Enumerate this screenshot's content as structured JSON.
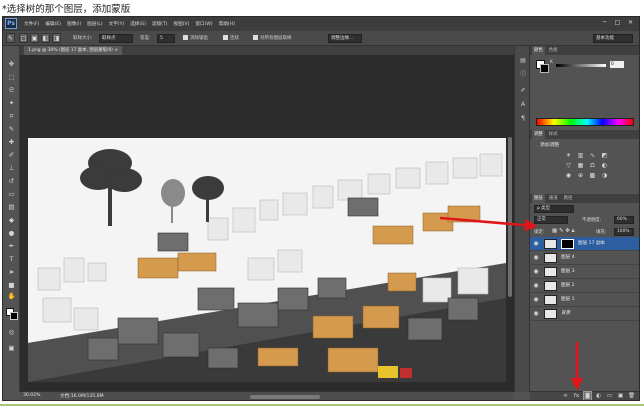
{
  "caption": "*选择树的那个图层，添加蒙版",
  "app": {
    "logo": "Ps",
    "menu": [
      "文件(F)",
      "编辑(E)",
      "图像(I)",
      "图层(L)",
      "文字(Y)",
      "选择(S)",
      "滤镜(T)",
      "视图(V)",
      "窗口(W)",
      "帮助(H)"
    ],
    "workspace": "基本功能",
    "window_controls": [
      "─",
      "□",
      "✕"
    ]
  },
  "options": {
    "sample_size_label": "取样大小:",
    "sample_size_value": "取样点",
    "tolerance_label": "容差:",
    "tolerance_value": "5",
    "antialias": "消除锯齿",
    "contiguous": "连续",
    "all_layers": "对所有图层取样",
    "refine_edge": "调整边缘..."
  },
  "document": {
    "tab_title": "1.png @ 30% (图层 17 副本, 图层蒙版/8) ×",
    "zoom": "30.02%",
    "doc_info": "文档:16.0M/135.8M"
  },
  "panels": {
    "color_tabs": [
      "颜色",
      "色板"
    ],
    "slider_label": "K",
    "slider_value": "0",
    "adjust_tabs": [
      "调整",
      "样式"
    ],
    "adjust_title": "添加调整",
    "layers_tabs": [
      "图层",
      "通道",
      "路径"
    ],
    "kind_label": "ρ 类型",
    "blend_mode": "正常",
    "opacity_label": "不透明度:",
    "opacity_value": "60%",
    "lock_label": "锁定:",
    "fill_label": "填充:",
    "fill_value": "100%"
  },
  "layers": [
    {
      "name": "图层 17 副本",
      "selected": true,
      "mask": true
    },
    {
      "name": "图层 4",
      "selected": false,
      "mask": false
    },
    {
      "name": "图层 3",
      "selected": false,
      "mask": false
    },
    {
      "name": "图层 2",
      "selected": false,
      "mask": false
    },
    {
      "name": "图层 1",
      "selected": false,
      "mask": false
    },
    {
      "name": "背景",
      "selected": false,
      "mask": false
    }
  ],
  "colors": {
    "annotation_arrow": "#e0151b",
    "selected_layer": "#2d5fa0",
    "roof_orange": "#d49a4d",
    "roof_gray": "#6e6e6e",
    "ghost_block": "#e9e9e9"
  }
}
